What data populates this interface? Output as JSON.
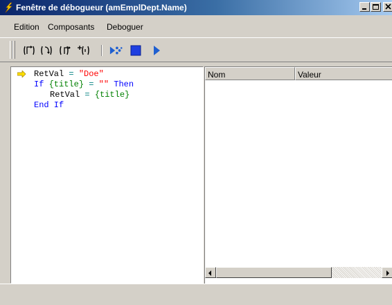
{
  "window": {
    "title": "Fenêtre de débogueur (amEmplDept.Name)",
    "title_color": "#0a246a",
    "controls": [
      "minimize-icon",
      "maximize-icon",
      "close-icon"
    ]
  },
  "menu": {
    "items": [
      "Edition",
      "Composants",
      "Deboguer"
    ]
  },
  "toolbar": {
    "buttons": [
      "step-into-icon",
      "step-over-icon",
      "step-out-icon",
      "run-to-cursor-icon",
      "animate-icon",
      "stop-icon",
      "go-icon"
    ]
  },
  "code": {
    "line1": {
      "var": "RetVal",
      "op": " = ",
      "str": "\"Doe\""
    },
    "line2": {
      "kw1": "If ",
      "fld": "{title}",
      "op": " = ",
      "str": "\"\"",
      "kw2": " Then"
    },
    "line3": {
      "var": "RetVal",
      "op": " = ",
      "fld": "{title}"
    },
    "line4": {
      "kw": "End If"
    },
    "colors": {
      "keyword": "#0000ff",
      "string": "#ff0000",
      "field": "#008000",
      "operator": "#008080"
    }
  },
  "variables": {
    "columns": [
      "Nom",
      "Valeur"
    ]
  }
}
